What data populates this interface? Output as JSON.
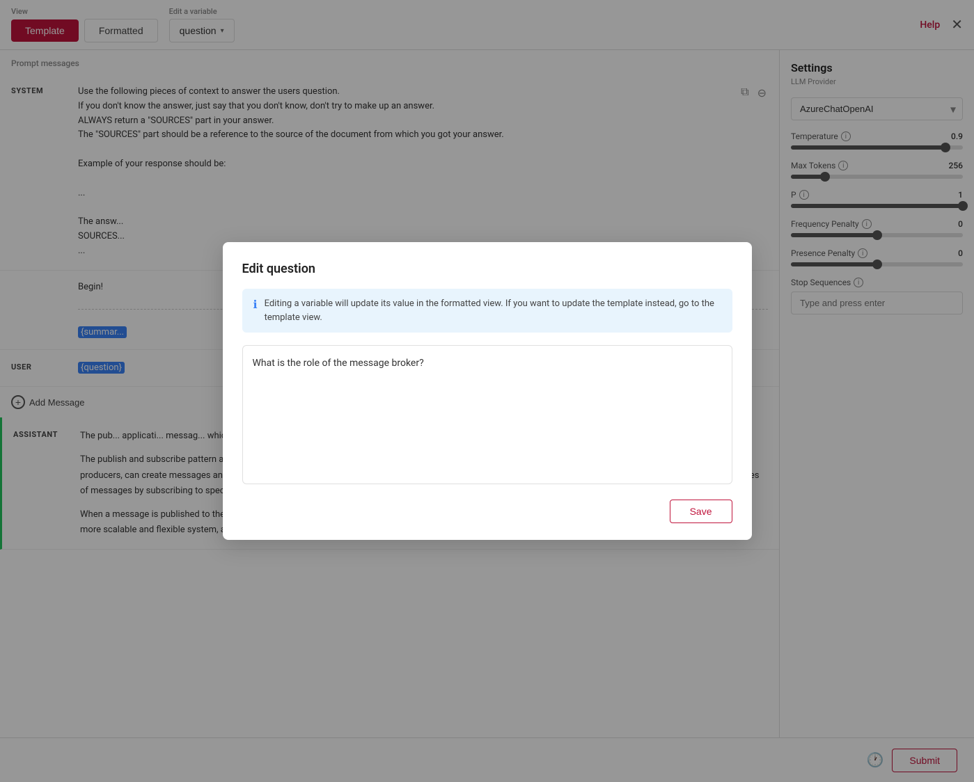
{
  "toolbar": {
    "view_label": "View",
    "template_btn": "Template",
    "formatted_btn": "Formatted",
    "edit_variable_label": "Edit a variable",
    "variable_dropdown": "question",
    "help_label": "Help"
  },
  "prompt_messages": {
    "label": "Prompt messages"
  },
  "system_message": {
    "role": "SYSTEM",
    "lines": [
      "Use the following pieces of context to answer the users question.",
      "If you don't know the answer, just say that you don't know, don't try to make up an answer.",
      "ALWAYS return a \"SOURCES\" part in your answer.",
      "The \"SOURCES\" part should be a reference to the source of the document from which you got your answer.",
      "",
      "Example of your response should be:",
      "",
      "...",
      "",
      "The answ...",
      "SOURCES...",
      "..."
    ]
  },
  "user_message": {
    "role": "USER",
    "variable": "{question}"
  },
  "begin_text": "Begin!",
  "summary_variable": "{summar...",
  "add_message_btn": "Add Message",
  "assistant_message": {
    "role": "ASSISTANT",
    "paragraphs": [
      "The pub... applicati... messag... which act as folders in the system.",
      "The publish and subscribe pattern allows for decoupling between the publishers of messages and the subscribers who consume them. Publishers, also known as producers, can create messages and publish them to the message broker without knowing the specific subscribers. Subscribers can register their interest in certain types of messages by subscribing to specific topics or queues.",
      "When a message is published to the broker, it is then distributed to all the subscribers who have expressed interest in that particular type of message. This allows for a more scalable and flexible system, as new"
    ]
  },
  "settings": {
    "title": "Settings",
    "llm_provider_label": "LLM Provider",
    "llm_provider_value": "AzureChatOpenAI",
    "temperature_label": "Temperature",
    "temperature_info": "?",
    "temperature_value": "0.9",
    "temperature_percent": 90,
    "max_tokens_label": "Max Tokens",
    "max_tokens_info": "?",
    "max_tokens_value": "256",
    "max_tokens_percent": 20,
    "p_label": "P",
    "p_info": "?",
    "p_value": "1",
    "p_percent": 100,
    "frequency_penalty_label": "Frequency Penalty",
    "frequency_penalty_info": "?",
    "frequency_penalty_value": "0",
    "frequency_percent": 50,
    "presence_penalty_label": "Presence Penalty",
    "presence_penalty_info": "?",
    "presence_penalty_value": "0",
    "presence_percent": 50,
    "stop_sequences_label": "Stop Sequences",
    "stop_sequences_info": "?",
    "stop_sequences_placeholder": "Type and press enter"
  },
  "bottom_bar": {
    "submit_btn": "Submit"
  },
  "modal": {
    "title": "Edit question",
    "info_text": "Editing a variable will update its value in the formatted view. If you want to update the template instead, go to the template view.",
    "textarea_value": "What is the role of the message broker?",
    "save_btn": "Save"
  }
}
